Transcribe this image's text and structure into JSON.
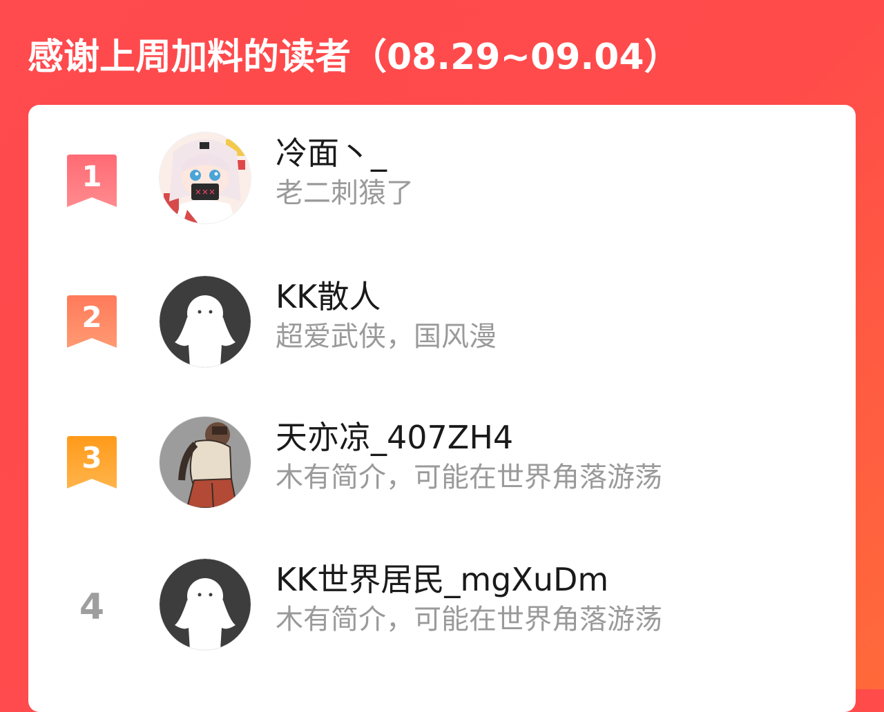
{
  "header": {
    "title": "感谢上周加料的读者（08.29~09.04）"
  },
  "readers": [
    {
      "rank": "1",
      "rank_style": "badge",
      "badge_color": "#ff5e6a",
      "avatar_icon": "anime-girl-avatar-icon",
      "nickname": "冷面丶_",
      "bio": "老二刺猿了"
    },
    {
      "rank": "2",
      "rank_style": "badge",
      "badge_color": "#ff7a5a",
      "avatar_icon": "default-ghost-avatar-icon",
      "nickname": "KK散人",
      "bio": "超爱武侠，国风漫"
    },
    {
      "rank": "3",
      "rank_style": "badge",
      "badge_color": "#ffa21a",
      "avatar_icon": "sketch-man-avatar-icon",
      "nickname": "天亦凉_407ZH4",
      "bio": "木有简介，可能在世界角落游荡"
    },
    {
      "rank": "4",
      "rank_style": "plain",
      "badge_color": "#9e9e9e",
      "avatar_icon": "default-ghost-avatar-icon",
      "nickname": "KK世界居民_mgXuDm",
      "bio": "木有简介，可能在世界角落游荡"
    }
  ]
}
